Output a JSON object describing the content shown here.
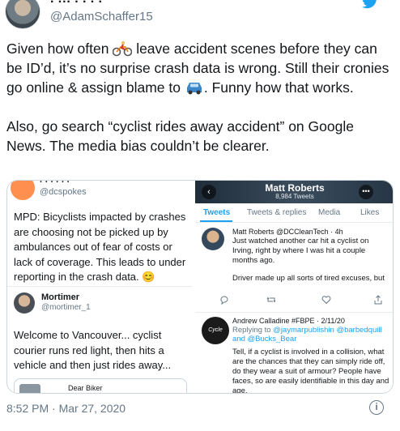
{
  "author": {
    "handle": "@AdamSchaffer15",
    "top_cut_text": "· ··· ·  · · ·"
  },
  "tweet": {
    "para1_a": "Given how often ",
    "para1_emoji1": "bicyclist-emoji",
    "para1_b": " leave accident scenes before they can be ID’d, it’s no surprise crash data is wrong. Still their cronies go online & assign blame to ",
    "para1_emoji2": "car-emoji",
    "para1_c": ". Funny how that works.",
    "para2": "Also, go search “cyclist rides away accident” on Google News. The media bias couldn’t be clearer.",
    "timestamp": "8:52 PM · Mar 27, 2020"
  },
  "left_screenshot": {
    "name1_cut": "· · · · · ·",
    "handle1": "@dcspokes",
    "text1": "MPD: Bicyclists impacted by crashes are choosing not be picked up by ambulances out of fear of costs or lack of coverage. This leads to under reporting in the crash data. 😊",
    "name2": "Mortimer",
    "handle2": "@mortimer_1",
    "text2": "Welcome to Vancouver... cyclist courier runs red light, then hits a vehicle and then just rides away...",
    "quote_name": "Dear Biker"
  },
  "right_screenshot": {
    "title": "Matt Roberts",
    "subtitle": "8,984 Tweets",
    "back_glyph": "‹",
    "more_glyph": "•••",
    "tabs": [
      "Tweets",
      "Tweets & replies",
      "Media",
      "Likes"
    ],
    "tweet1_head": "Matt Roberts @DCCleanTech · 4h",
    "tweet1_text": "Just watched another car hit a cyclist on Irving, right by where I was hit a couple months ago.",
    "tweet1_text_b": "Driver made up all sorts of tired excuses, but speeding, tailgating, and no look",
    "tweet2_avatar_text": "Cycle Stance",
    "tweet2_head": "Andrew Calladine #FBPE · 2/11/20",
    "tweet2_reply_prefix": "Replying to ",
    "tweet2_reply_users": "@jaymarpublishin @barbedquill and @Bucks_Bear",
    "tweet2_text": "Tell, if a cyclist is involved in a collision, what are the chances that they can simply ride off, do they wear a suit of armour? People have faces, so are easily identifiable in this day and age."
  },
  "icons": {
    "info": "i"
  },
  "colors": {
    "link": "#1da1f2",
    "muted": "#657786",
    "text": "#14171a"
  }
}
